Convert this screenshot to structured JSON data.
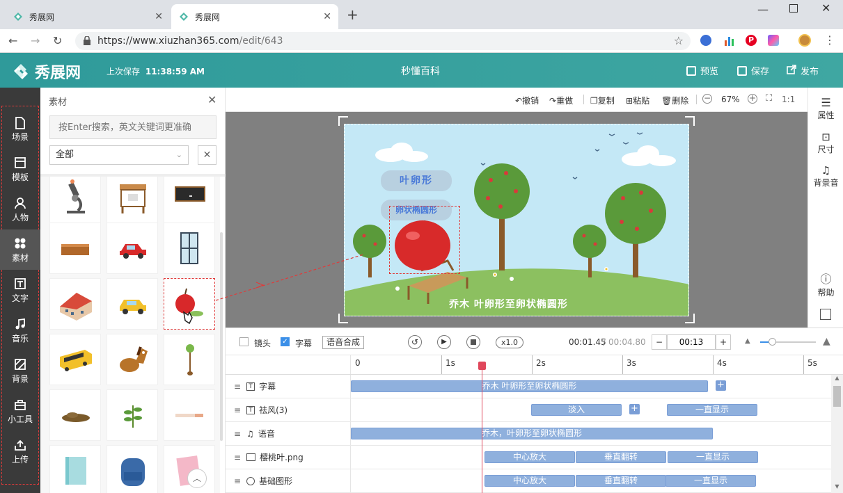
{
  "browser": {
    "tabs": [
      {
        "label": "秀展网",
        "active": false
      },
      {
        "label": "秀展网",
        "active": true
      }
    ],
    "new_tab": "+",
    "url_scheme": "https://",
    "url_host": "www.xiuzhan365.com",
    "url_path": "/edit/643",
    "window_controls": [
      "minimize",
      "maximize",
      "close"
    ]
  },
  "header": {
    "logo_text": "秀展网",
    "last_saved_label": "上次保存",
    "last_saved_time": "11:38:59 AM",
    "project_title": "秒懂百科",
    "actions": [
      {
        "label": "预览",
        "icon": "preview-icon"
      },
      {
        "label": "保存",
        "icon": "save-icon"
      },
      {
        "label": "发布",
        "icon": "publish-icon"
      }
    ]
  },
  "leftnav": {
    "items": [
      {
        "label": "场景",
        "icon": "scene-icon"
      },
      {
        "label": "模板",
        "icon": "template-icon"
      },
      {
        "label": "人物",
        "icon": "person-icon"
      },
      {
        "label": "素材",
        "icon": "material-icon",
        "active": true
      },
      {
        "label": "文字",
        "icon": "text-icon"
      },
      {
        "label": "音乐",
        "icon": "music-icon"
      },
      {
        "label": "背景",
        "icon": "background-icon"
      },
      {
        "label": "小工具",
        "icon": "toolbox-icon"
      },
      {
        "label": "上传",
        "icon": "upload-icon"
      }
    ]
  },
  "panel": {
    "title": "素材",
    "search_placeholder": "按Enter搜索，英文关键词更准确",
    "category_selected": "全部",
    "items": [
      "microscope",
      "desk",
      "blackboard",
      "table",
      "red-car",
      "window",
      "building",
      "taxi",
      "apple",
      "school-bus",
      "horse",
      "sapling",
      "soil",
      "plant",
      "ruler",
      "book",
      "backpack",
      "notebook"
    ]
  },
  "editor": {
    "toolbar": {
      "undo": "撤销",
      "redo": "重做",
      "copy": "复制",
      "paste": "粘贴",
      "delete": "删除",
      "zoom": "67%",
      "ratio": "1:1"
    },
    "canvas": {
      "label1": "叶卵形",
      "label2": "卵状椭圆形",
      "caption": "乔木  叶卵形至卵状椭圆形"
    }
  },
  "rightbar": {
    "items": [
      {
        "label": "属性",
        "icon": "properties-icon"
      },
      {
        "label": "尺寸",
        "icon": "size-icon"
      },
      {
        "label": "背景音",
        "icon": "bg-music-icon"
      },
      {
        "label": "帮助",
        "icon": "help-icon"
      }
    ]
  },
  "timeline": {
    "controls": {
      "camera_label": "镜头",
      "camera_checked": false,
      "subtitle_label": "字幕",
      "subtitle_checked": true,
      "tts_button": "语音合成",
      "speed": "x1.0",
      "current_time": "00:01.45",
      "separator": "/",
      "total_time": "00:04.80",
      "duration": "00:13",
      "minus": "−",
      "plus": "+"
    },
    "ruler": [
      "0",
      "1s",
      "2s",
      "3s",
      "4s",
      "5s"
    ],
    "tracks": [
      {
        "label": "字幕",
        "icon": "text-track-icon",
        "clips": [
          {
            "text": "乔木   叶卵形至卵状椭圆形"
          }
        ]
      },
      {
        "label": "祛风(3)",
        "icon": "text-track-icon",
        "clips": [
          {
            "text": "淡入"
          },
          {
            "text": "一直显示"
          }
        ]
      },
      {
        "label": "语音",
        "icon": "voice-track-icon",
        "clips": [
          {
            "text": "乔木，叶卵形至卵状椭圆形"
          }
        ]
      },
      {
        "label": "樱桃叶.png",
        "icon": "image-track-icon",
        "clips": [
          {
            "text": "中心放大"
          },
          {
            "text": "垂直翻转"
          },
          {
            "text": "一直显示"
          }
        ]
      },
      {
        "label": "基础图形",
        "icon": "shape-track-icon",
        "clips": [
          {
            "text": "中心放大"
          },
          {
            "text": "垂直翻转"
          },
          {
            "text": "一直显示"
          }
        ]
      }
    ]
  },
  "colors": {
    "header_bg": "#3aa3a0",
    "leftnav_bg": "#3a3a3a",
    "clip_bg": "#8fb0dd",
    "playhead": "#e0475b",
    "drag_highlight": "#e03a3a"
  }
}
